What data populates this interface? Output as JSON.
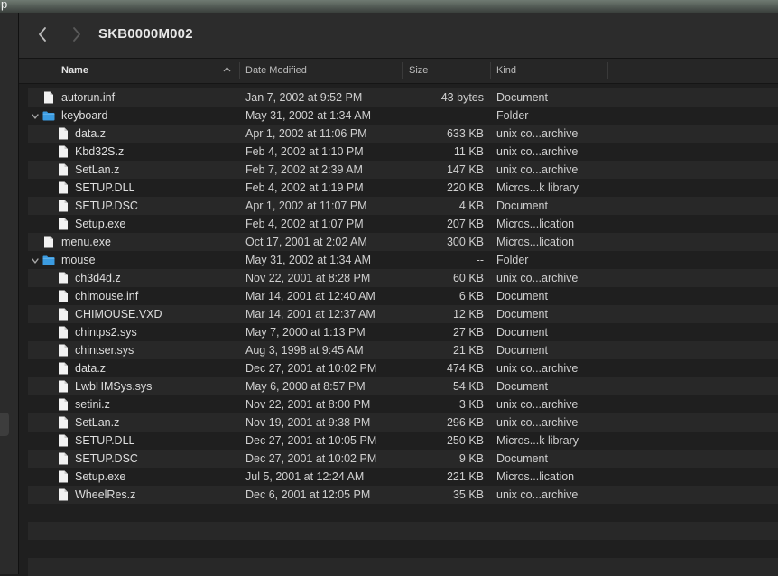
{
  "app": {
    "menu_letter": "p"
  },
  "toolbar": {
    "title": "SKB0000M002"
  },
  "columns": {
    "name": "Name",
    "date": "Date Modified",
    "size": "Size",
    "kind": "Kind"
  },
  "rows": [
    {
      "name": "autorun.inf",
      "date": "Jan 7, 2002 at 9:52 PM",
      "size": "43 bytes",
      "kind": "Document",
      "level": 0,
      "type": "file"
    },
    {
      "name": "keyboard",
      "date": "May 31, 2002 at 1:34 AM",
      "size": "--",
      "kind": "Folder",
      "level": 0,
      "type": "folder"
    },
    {
      "name": "data.z",
      "date": "Apr 1, 2002 at 11:06 PM",
      "size": "633 KB",
      "kind": "unix co...archive",
      "level": 1,
      "type": "file"
    },
    {
      "name": "Kbd32S.z",
      "date": "Feb 4, 2002 at 1:10 PM",
      "size": "11 KB",
      "kind": "unix co...archive",
      "level": 1,
      "type": "file"
    },
    {
      "name": "SetLan.z",
      "date": "Feb 7, 2002 at 2:39 AM",
      "size": "147 KB",
      "kind": "unix co...archive",
      "level": 1,
      "type": "file"
    },
    {
      "name": "SETUP.DLL",
      "date": "Feb 4, 2002 at 1:19 PM",
      "size": "220 KB",
      "kind": "Micros...k library",
      "level": 1,
      "type": "file"
    },
    {
      "name": "SETUP.DSC",
      "date": "Apr 1, 2002 at 11:07 PM",
      "size": "4 KB",
      "kind": "Document",
      "level": 1,
      "type": "file"
    },
    {
      "name": "Setup.exe",
      "date": "Feb 4, 2002 at 1:07 PM",
      "size": "207 KB",
      "kind": "Micros...lication",
      "level": 1,
      "type": "file"
    },
    {
      "name": "menu.exe",
      "date": "Oct 17, 2001 at 2:02 AM",
      "size": "300 KB",
      "kind": "Micros...lication",
      "level": 0,
      "type": "file"
    },
    {
      "name": "mouse",
      "date": "May 31, 2002 at 1:34 AM",
      "size": "--",
      "kind": "Folder",
      "level": 0,
      "type": "folder"
    },
    {
      "name": "ch3d4d.z",
      "date": "Nov 22, 2001 at 8:28 PM",
      "size": "60 KB",
      "kind": "unix co...archive",
      "level": 1,
      "type": "file"
    },
    {
      "name": "chimouse.inf",
      "date": "Mar 14, 2001 at 12:40 AM",
      "size": "6 KB",
      "kind": "Document",
      "level": 1,
      "type": "file"
    },
    {
      "name": "CHIMOUSE.VXD",
      "date": "Mar 14, 2001 at 12:37 AM",
      "size": "12 KB",
      "kind": "Document",
      "level": 1,
      "type": "file"
    },
    {
      "name": "chintps2.sys",
      "date": "May 7, 2000 at 1:13 PM",
      "size": "27 KB",
      "kind": "Document",
      "level": 1,
      "type": "file"
    },
    {
      "name": "chintser.sys",
      "date": "Aug 3, 1998 at 9:45 AM",
      "size": "21 KB",
      "kind": "Document",
      "level": 1,
      "type": "file"
    },
    {
      "name": "data.z",
      "date": "Dec 27, 2001 at 10:02 PM",
      "size": "474 KB",
      "kind": "unix co...archive",
      "level": 1,
      "type": "file"
    },
    {
      "name": "LwbHMSys.sys",
      "date": "May 6, 2000 at 8:57 PM",
      "size": "54 KB",
      "kind": "Document",
      "level": 1,
      "type": "file"
    },
    {
      "name": "setini.z",
      "date": "Nov 22, 2001 at 8:00 PM",
      "size": "3 KB",
      "kind": "unix co...archive",
      "level": 1,
      "type": "file"
    },
    {
      "name": "SetLan.z",
      "date": "Nov 19, 2001 at 9:38 PM",
      "size": "296 KB",
      "kind": "unix co...archive",
      "level": 1,
      "type": "file"
    },
    {
      "name": "SETUP.DLL",
      "date": "Dec 27, 2001 at 10:05 PM",
      "size": "250 KB",
      "kind": "Micros...k library",
      "level": 1,
      "type": "file"
    },
    {
      "name": "SETUP.DSC",
      "date": "Dec 27, 2001 at 10:02 PM",
      "size": "9 KB",
      "kind": "Document",
      "level": 1,
      "type": "file"
    },
    {
      "name": "Setup.exe",
      "date": "Jul 5, 2001 at 12:24 AM",
      "size": "221 KB",
      "kind": "Micros...lication",
      "level": 1,
      "type": "file"
    },
    {
      "name": "WheelRes.z",
      "date": "Dec 6, 2001 at 12:05 PM",
      "size": "35 KB",
      "kind": "unix co...archive",
      "level": 1,
      "type": "file"
    }
  ],
  "colors": {
    "folder": "#3b9be0",
    "file": "#f2f2f2",
    "accent": "#3b9be0"
  },
  "icons": {
    "back": "chevron-left-icon",
    "forward": "chevron-right-icon",
    "sort": "chevron-up-icon",
    "disclosure": "chevron-down-icon"
  }
}
